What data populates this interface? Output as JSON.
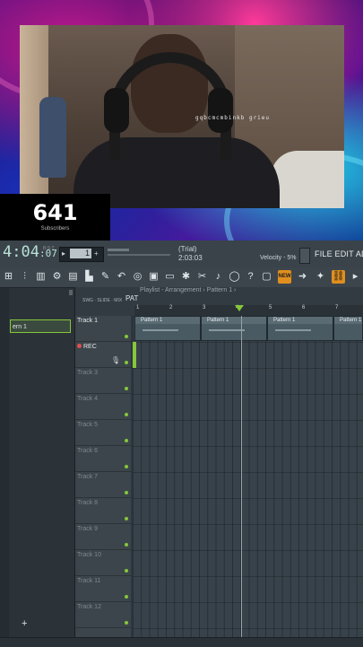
{
  "stream": {
    "overlay_text": "gqbcmcmbinkb grieu",
    "subscribers_count": "641",
    "subscribers_label": "Subscribers"
  },
  "transport": {
    "time": "4:04",
    "time_small": ":07",
    "bst_label": "B:S:T",
    "pattern_number": "1",
    "trial_label": "(Trial)",
    "trial_time": "2:03:03",
    "velocity_label": "Velocity - 5%",
    "menu": "FILE EDIT ADD P"
  },
  "toolbar": {
    "highlight_label": "NEW",
    "icons": [
      "grid-icon",
      "mixer-icon",
      "piano-icon",
      "plugin-icon",
      "browser-icon",
      "folder-icon",
      "save-icon",
      "undo-icon",
      "pattern-icon",
      "scissors-icon",
      "mic-icon",
      "record-icon",
      "help-icon",
      "screen-icon",
      "info-icon",
      "new-icon",
      "arrow-icon",
      "magic-icon",
      "link-icon"
    ]
  },
  "picker": {
    "item": "ern 1"
  },
  "playlist": {
    "title": "Playlist - Arrangement › Pattern 1 ›",
    "pattern_label": "PAT",
    "tools_label": "SWG · SLIDE · MIX",
    "ruler": [
      "1",
      "2",
      "3",
      "4",
      "5",
      "6",
      "7"
    ],
    "clip_label": "Pattern 1"
  },
  "tracks": [
    {
      "name": "Track 1",
      "first": true
    },
    {
      "name": "REC",
      "rec": true
    },
    {
      "name": "Track 3"
    },
    {
      "name": "Track 4"
    },
    {
      "name": "Track 5"
    },
    {
      "name": "Track 6"
    },
    {
      "name": "Track 7"
    },
    {
      "name": "Track 8"
    },
    {
      "name": "Track 9"
    },
    {
      "name": "Track 10"
    },
    {
      "name": "Track 11"
    },
    {
      "name": "Track 12"
    }
  ],
  "add_label": "+"
}
